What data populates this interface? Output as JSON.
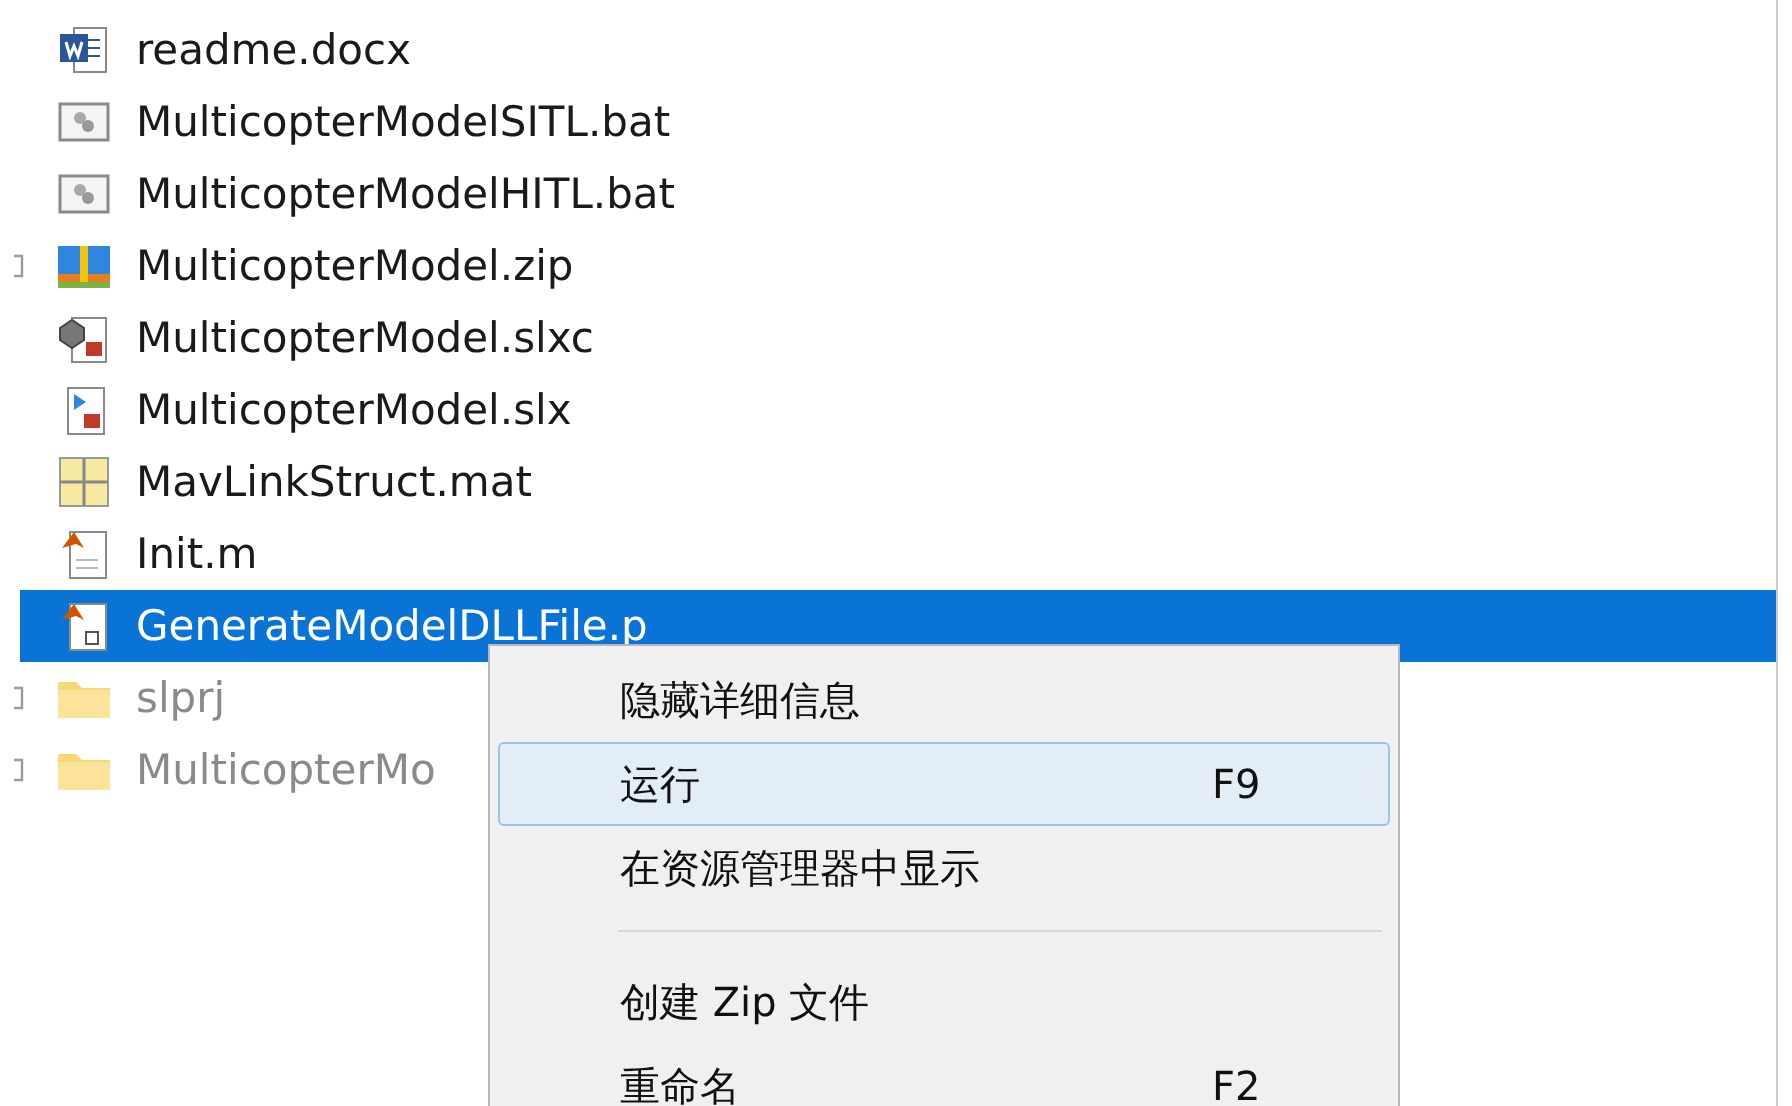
{
  "files": [
    {
      "name": "readme.docx",
      "kind": "word",
      "expander": false,
      "selected": false,
      "dimmed": false
    },
    {
      "name": "MulticopterModelSITL.bat",
      "kind": "bat",
      "expander": false,
      "selected": false,
      "dimmed": false
    },
    {
      "name": "MulticopterModelHITL.bat",
      "kind": "bat",
      "expander": false,
      "selected": false,
      "dimmed": false
    },
    {
      "name": "MulticopterModel.zip",
      "kind": "zip",
      "expander": true,
      "selected": false,
      "dimmed": false
    },
    {
      "name": "MulticopterModel.slxc",
      "kind": "slxc",
      "expander": false,
      "selected": false,
      "dimmed": false
    },
    {
      "name": "MulticopterModel.slx",
      "kind": "slx",
      "expander": false,
      "selected": false,
      "dimmed": false
    },
    {
      "name": "MavLinkStruct.mat",
      "kind": "mat",
      "expander": false,
      "selected": false,
      "dimmed": false
    },
    {
      "name": "Init.m",
      "kind": "mfile",
      "expander": false,
      "selected": false,
      "dimmed": false
    },
    {
      "name": "GenerateModelDLLFile.p",
      "kind": "pfile",
      "expander": false,
      "selected": true,
      "dimmed": false
    },
    {
      "name": "slprj",
      "kind": "folder",
      "expander": true,
      "selected": false,
      "dimmed": true
    },
    {
      "name": "MulticopterMo",
      "kind": "folder",
      "expander": true,
      "selected": false,
      "dimmed": true
    }
  ],
  "context_menu": [
    {
      "kind": "item",
      "label": "隐藏详细信息",
      "selected": false
    },
    {
      "kind": "item",
      "label": "运行",
      "shortcut": "F9",
      "selected": true
    },
    {
      "kind": "item",
      "label": "在资源管理器中显示",
      "selected": false
    },
    {
      "kind": "separator"
    },
    {
      "kind": "item",
      "label": "创建 Zip 文件",
      "selected": false
    },
    {
      "kind": "item",
      "label": "重命名",
      "shortcut": "F2",
      "selected": false
    }
  ]
}
